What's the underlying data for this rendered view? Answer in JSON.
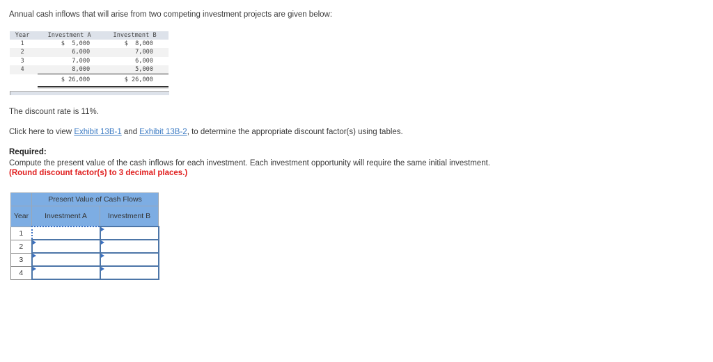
{
  "intro": "Annual cash inflows that will arise from two competing investment projects are given below:",
  "given_table": {
    "headers": [
      "Year",
      "Investment A",
      "Investment B"
    ],
    "rows": [
      {
        "year": "1",
        "a": "$  5,000",
        "b": "$  8,000"
      },
      {
        "year": "2",
        "a": "6,000",
        "b": "7,000"
      },
      {
        "year": "3",
        "a": "7,000",
        "b": "6,000"
      },
      {
        "year": "4",
        "a": "8,000",
        "b": "5,000"
      }
    ],
    "total": {
      "a": "$ 26,000",
      "b": "$ 26,000"
    }
  },
  "discount_text": "The discount rate is 11%.",
  "exhibits": {
    "prefix": "Click here to view ",
    "link1": "Exhibit 13B-1",
    "middle": " and ",
    "link2": "Exhibit 13B-2",
    "suffix": ", to determine the appropriate discount factor(s) using tables."
  },
  "required": {
    "label": "Required:",
    "text": "Compute the present value of the cash inflows for each investment. Each investment opportunity will require the same initial investment. ",
    "note": "(Round discount factor(s) to 3 decimal places.)"
  },
  "pv_table": {
    "title": "Present Value of Cash Flows",
    "col_year": "Year",
    "col_a": "Investment A",
    "col_b": "Investment B",
    "rows": [
      {
        "year": "1",
        "a_value": "",
        "b_value": ""
      },
      {
        "year": "2",
        "a_value": "",
        "b_value": ""
      },
      {
        "year": "3",
        "a_value": "",
        "b_value": ""
      },
      {
        "year": "4",
        "a_value": "",
        "b_value": ""
      }
    ]
  },
  "colors": {
    "link": "#3e7cc4",
    "note_red": "#e02020",
    "header_blue": "#7dade3",
    "input_border": "#4d76a8"
  }
}
